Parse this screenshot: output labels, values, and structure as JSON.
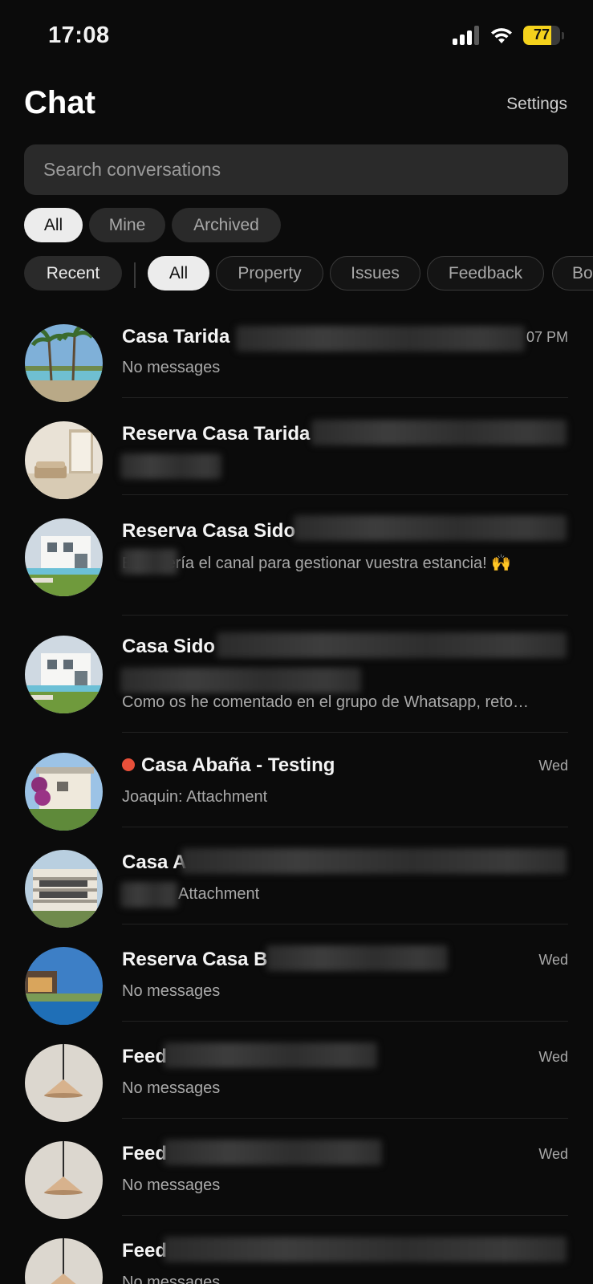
{
  "status": {
    "time": "17:08",
    "battery": "77"
  },
  "header": {
    "title": "Chat",
    "settings_label": "Settings"
  },
  "search": {
    "placeholder": "Search conversations"
  },
  "ownership_filters": [
    {
      "label": "All",
      "active": true
    },
    {
      "label": "Mine",
      "active": false
    },
    {
      "label": "Archived",
      "active": false
    }
  ],
  "sort_label": "Recent",
  "category_filters": [
    {
      "label": "All",
      "active": true
    },
    {
      "label": "Property",
      "active": false
    },
    {
      "label": "Issues",
      "active": false
    },
    {
      "label": "Feedback",
      "active": false
    },
    {
      "label": "Bo",
      "active": false
    }
  ],
  "conversations": [
    {
      "title": "Casa Tarida",
      "time": "07 PM",
      "preview": "No messages",
      "avatar": "palm-pool"
    },
    {
      "title": "Reserva Casa Tarida",
      "time": "",
      "preview": "",
      "avatar": "living-room"
    },
    {
      "title": "Reserva Casa Sido",
      "time": "",
      "preview": "Este sería el canal para gestionar vuestra estancia! 🙌",
      "avatar": "white-villa"
    },
    {
      "title": "Casa Sido",
      "time": "",
      "preview": "Como os he comentado en el grupo de Whatsapp, reto…",
      "avatar": "white-villa"
    },
    {
      "title": "Casa Abaña - Testing",
      "time": "Wed",
      "preview": "Joaquin: Attachment",
      "avatar": "flower-house",
      "unread": true
    },
    {
      "title": "Casa A",
      "time": "",
      "preview": "Attachment",
      "avatar": "apartment"
    },
    {
      "title": "Reserva Casa B",
      "time": "Wed",
      "preview": "No messages",
      "avatar": "infinity-pool"
    },
    {
      "title": "Feed",
      "time": "Wed",
      "preview": "No messages",
      "avatar": "pendant-lamp"
    },
    {
      "title": "Feed",
      "time": "Wed",
      "preview": "No messages",
      "avatar": "pendant-lamp"
    },
    {
      "title": "Feed",
      "time": "",
      "preview": "No messages",
      "avatar": "pendant-lamp"
    }
  ]
}
